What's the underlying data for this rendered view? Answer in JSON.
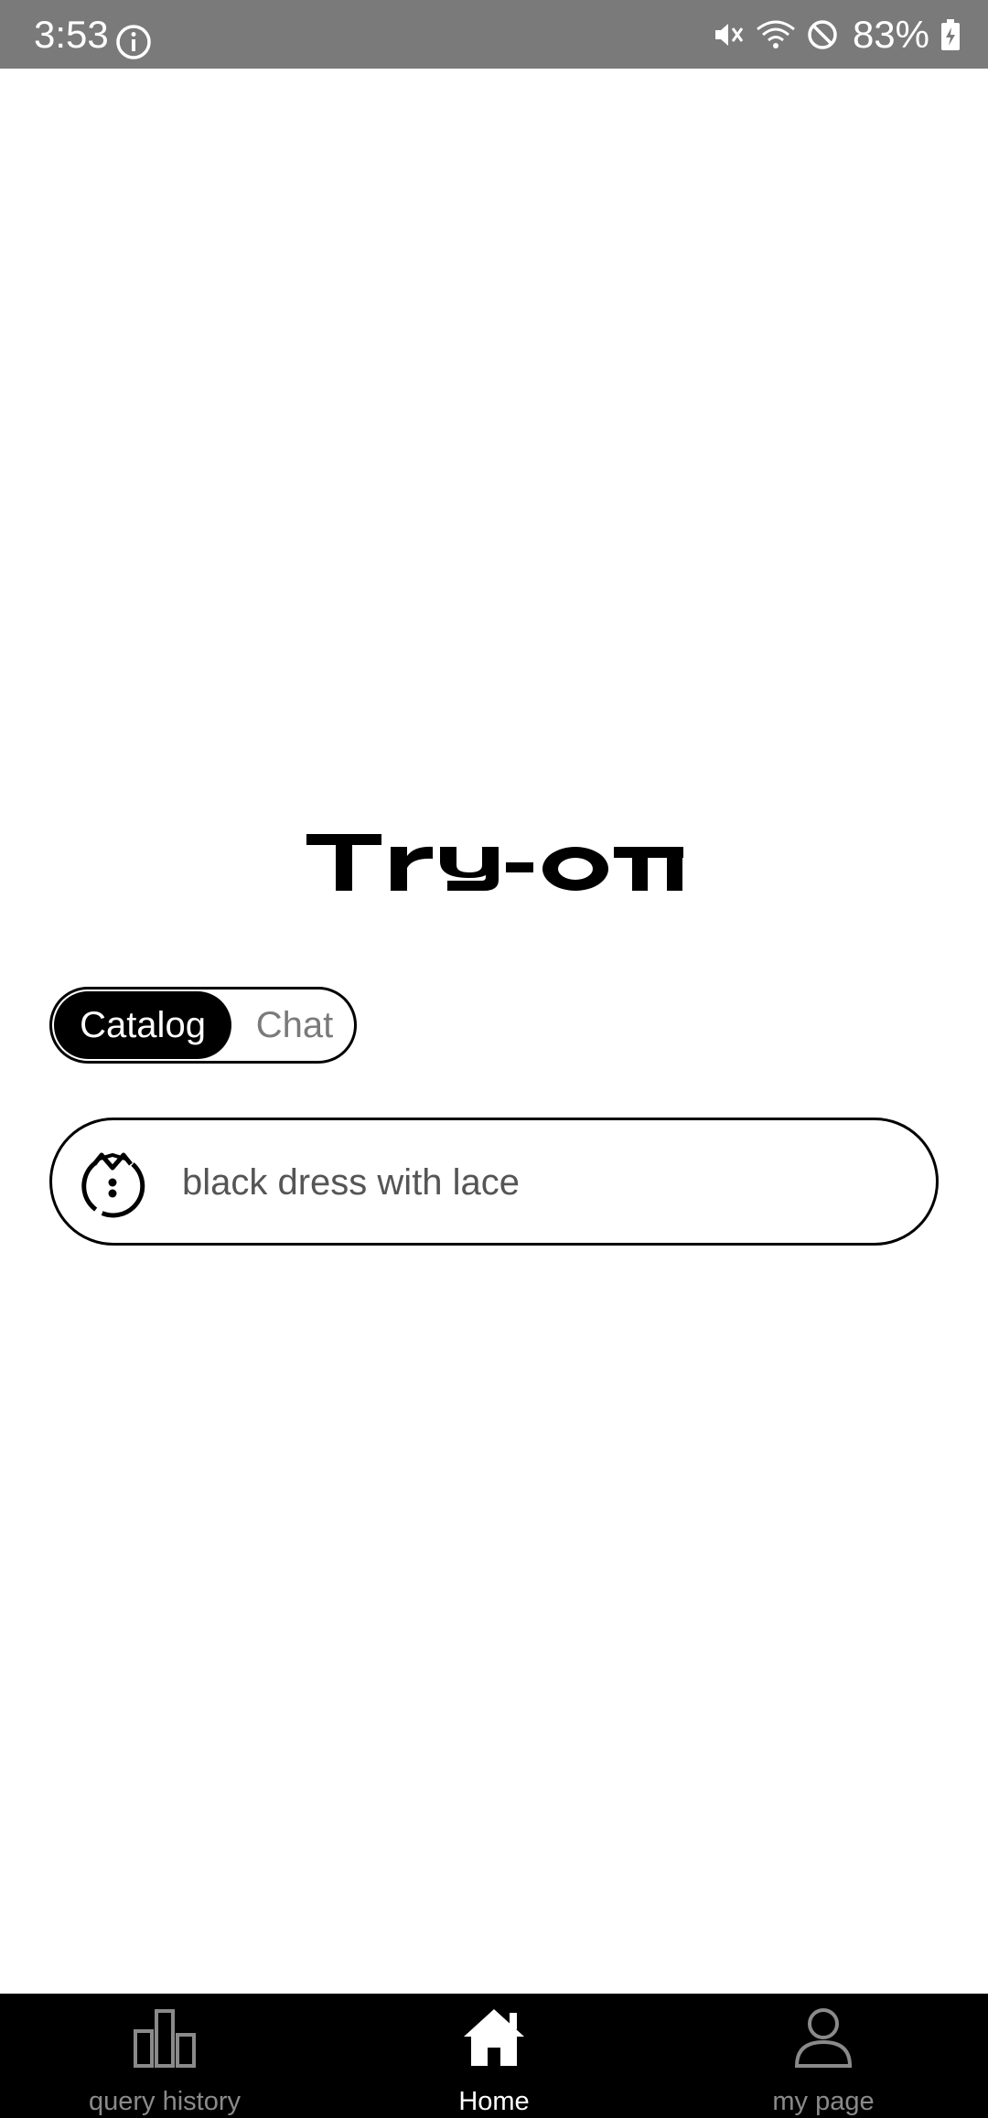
{
  "status_bar": {
    "time": "3:53",
    "battery": "83%",
    "icons": [
      "info-icon",
      "vibrate-muted-icon",
      "wifi-icon",
      "do-not-disturb-icon",
      "battery-charging-icon"
    ]
  },
  "logo": {
    "text": "TRY-ON"
  },
  "mode_toggle": {
    "options": [
      "Catalog",
      "Chat"
    ],
    "selected": "Catalog"
  },
  "search": {
    "value": "black dress with lace",
    "icon": "shirt-icon"
  },
  "bottom_nav": {
    "items": [
      {
        "label": "query history",
        "icon": "bar-chart-icon",
        "active": false
      },
      {
        "label": "Home",
        "icon": "home-icon",
        "active": true
      },
      {
        "label": "my page",
        "icon": "person-icon",
        "active": false
      }
    ]
  },
  "colors": {
    "status_bar_bg": "#7a7a7a",
    "accent": "#000000",
    "inactive_text": "#7a7a7a",
    "background": "#ffffff"
  }
}
